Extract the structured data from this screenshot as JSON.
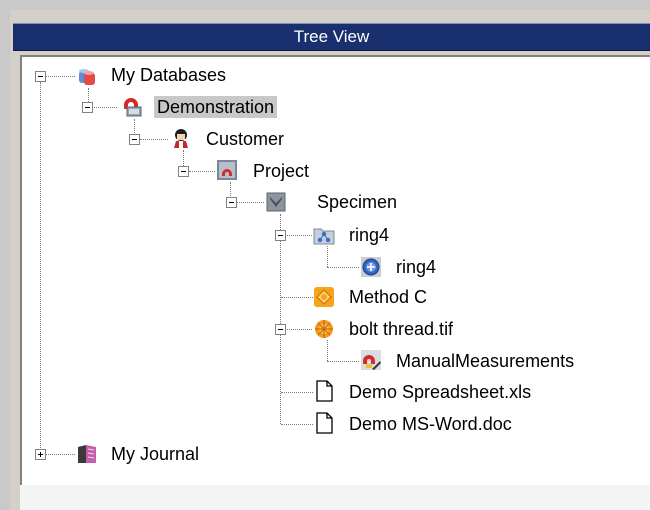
{
  "panel": {
    "title": "Tree View"
  },
  "tree": {
    "my_databases": "My Databases",
    "demonstration": "Demonstration",
    "customer": "Customer",
    "project": "Project",
    "specimen": "Specimen",
    "ring4_folder": "ring4",
    "ring4_item": "ring4",
    "method_c": "Method C",
    "bolt_thread": "bolt thread.tif",
    "manual_measurements": "ManualMeasurements",
    "demo_spreadsheet": "Demo Spreadsheet.xls",
    "demo_msword": "Demo MS-Word.doc",
    "my_journal": "My Journal"
  },
  "icons": {
    "my_databases": "databases-icon",
    "demonstration": "database-icon",
    "customer": "customer-icon",
    "project": "project-icon",
    "specimen": "specimen-icon",
    "ring4_folder": "sample-folder-icon",
    "ring4_item": "ring-sample-icon",
    "method_c": "method-icon",
    "bolt_thread": "image-icon",
    "manual_measurements": "measurement-icon",
    "demo_spreadsheet": "document-icon",
    "demo_msword": "document-icon",
    "my_journal": "journal-icon"
  },
  "colors": {
    "title_bar": "#1a2f6e",
    "selection": "#c8c8c8",
    "accent_red": "#d42a2a"
  }
}
